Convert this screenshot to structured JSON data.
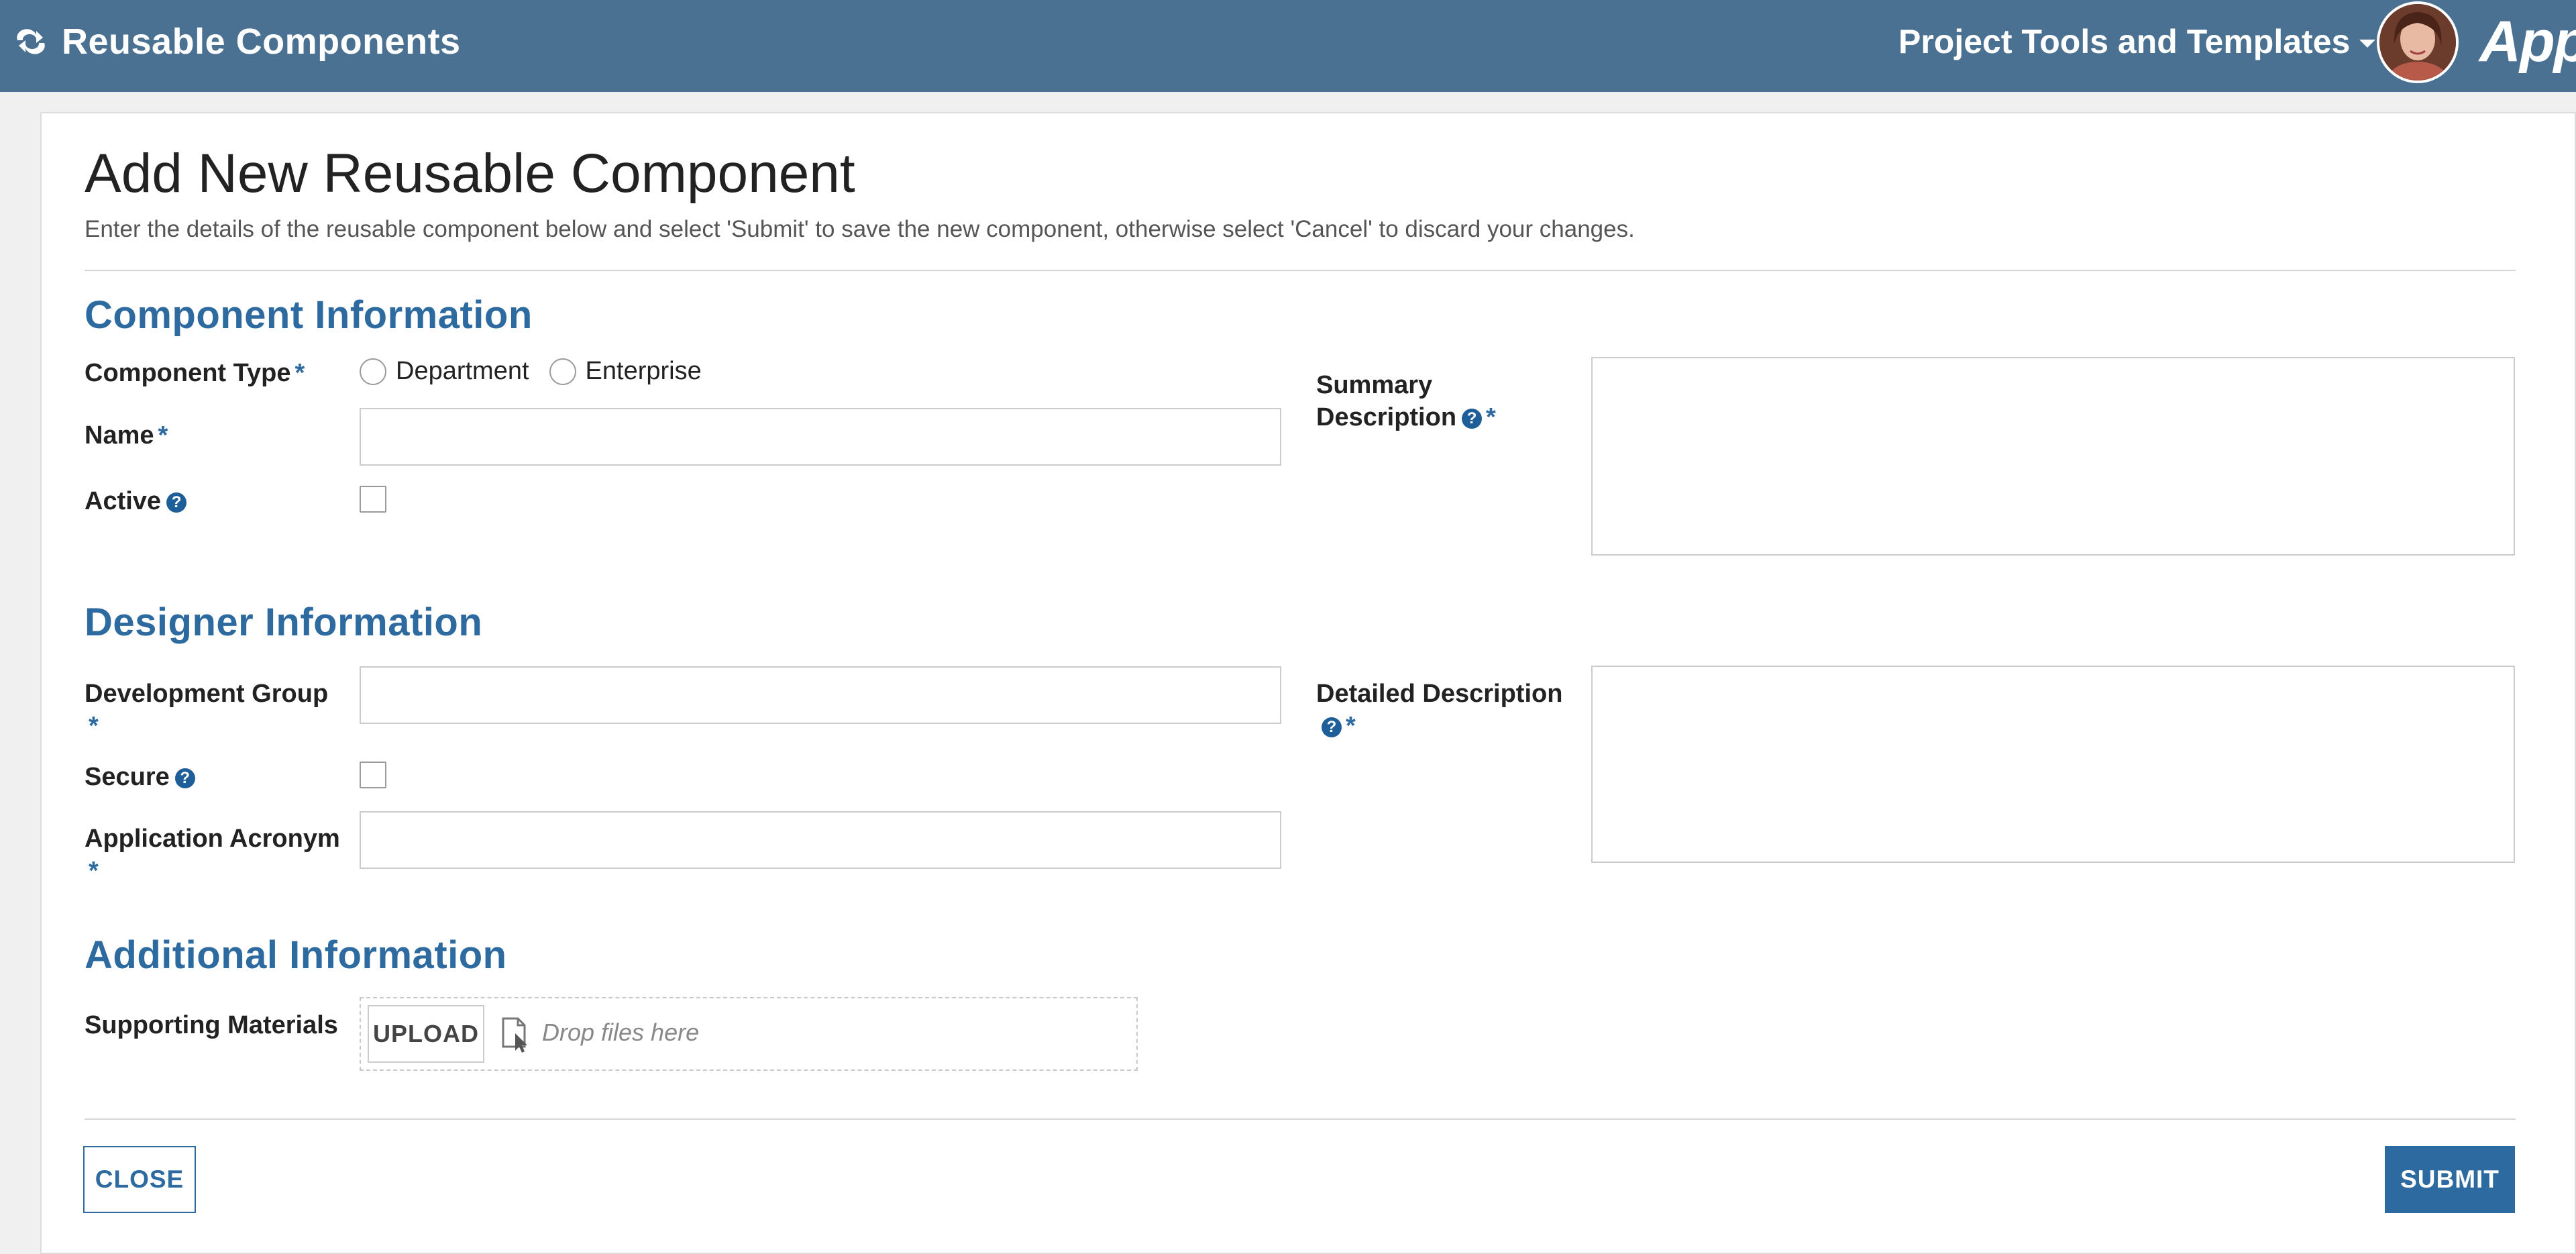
{
  "header": {
    "app_title": "Reusable Components",
    "nav_menu": "Project Tools and Templates",
    "brand": "Appia"
  },
  "page": {
    "title": "Add New Reusable Component",
    "description": "Enter the details of the reusable component below and select 'Submit' to save the new component, otherwise select 'Cancel' to discard your changes."
  },
  "sections": {
    "component": "Component Information",
    "designer": "Designer Information",
    "additional": "Additional Information"
  },
  "fields": {
    "component_type": {
      "label": "Component Type",
      "options": [
        "Department",
        "Enterprise"
      ],
      "selected": ""
    },
    "name": {
      "label": "Name",
      "value": ""
    },
    "active": {
      "label": "Active",
      "checked": false
    },
    "summary_description": {
      "label_line1": "Summary",
      "label_line2": "Description",
      "value": ""
    },
    "development_group": {
      "label": "Development Group",
      "value": ""
    },
    "secure": {
      "label": "Secure",
      "checked": false
    },
    "application_acronym": {
      "label": "Application Acronym",
      "value": ""
    },
    "detailed_description": {
      "label": "Detailed Description",
      "value": ""
    },
    "supporting_materials": {
      "label": "Supporting Materials",
      "upload_label": "UPLOAD",
      "drop_text": "Drop files here"
    }
  },
  "required_mark": "*",
  "help_glyph": "?",
  "buttons": {
    "close": "CLOSE",
    "submit": "SUBMIT"
  },
  "colors": {
    "header_bg": "#4a7191",
    "accent": "#2c6aa0",
    "help_icon": "#1f5f99"
  },
  "icons": {
    "app": "refresh-arrows-icon",
    "menu": "chevron-down-icon",
    "help": "question-circle-icon",
    "file": "file-drop-icon",
    "resize": "resize-grip-icon"
  }
}
